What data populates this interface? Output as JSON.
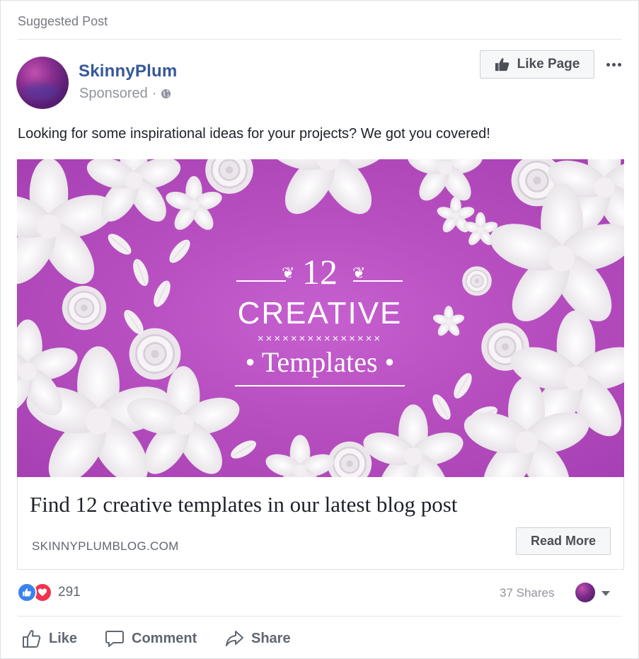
{
  "header": {
    "suggested_label": "Suggested Post"
  },
  "page": {
    "name": "SkinnyPlum",
    "sponsored_label": "Sponsored",
    "separator": "·"
  },
  "like_page_button": {
    "label": "Like Page",
    "icon": "thumbs-up-icon"
  },
  "more_options": {
    "icon": "more-options-icon"
  },
  "post": {
    "text": "Looking for some inspirational ideas for your projects? We got you covered!"
  },
  "hero_image": {
    "number": "12",
    "line1": "CREATIVE",
    "crosses": "×××××××××××××××",
    "line2": "• Templates •",
    "background_color": "#b84fc1"
  },
  "link": {
    "title": "Find 12 creative templates in our latest blog post",
    "domain": "SKINNYPLUMBLOG.COM",
    "cta_label": "Read More"
  },
  "stats": {
    "reactions_count": "291",
    "shares": "37 Shares"
  },
  "actions": {
    "like": "Like",
    "comment": "Comment",
    "share": "Share"
  },
  "colors": {
    "link_blue": "#365899",
    "like_blue": "#3b82f0",
    "love_red": "#f0334f",
    "muted_text": "#606770"
  }
}
